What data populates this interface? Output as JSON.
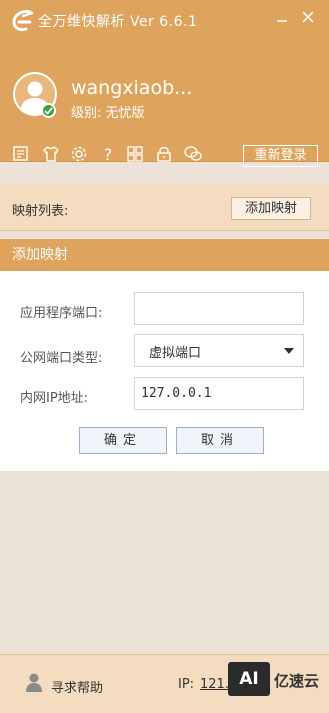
{
  "app": {
    "title": "全万维快解析 Ver 6.6.1"
  },
  "user": {
    "name": "wangxiaob...",
    "level": "级别: 无忧版",
    "relogin_label": "重新登录"
  },
  "toolbar": {
    "icons": [
      "notes-icon",
      "tshirt-icon",
      "gear-icon",
      "help-icon",
      "grid-icon",
      "lock-icon",
      "chat-icon"
    ]
  },
  "map_list": {
    "label": "映射列表:",
    "add_button": "添加映射"
  },
  "add_panel": {
    "title": "添加映射",
    "app_port_label": "应用程序端口:",
    "app_port_value": "",
    "public_port_type_label": "公网端口类型:",
    "public_port_type_value": "虚拟端口",
    "lan_ip_label": "内网IP地址:",
    "lan_ip_value": "127.0.0.1",
    "confirm_label": "确定",
    "cancel_label": "取消"
  },
  "footer": {
    "help_label": "寻求帮助",
    "ip_label": "IP:",
    "ip_value": "121.11.1.8",
    "watermark_box": "AI",
    "watermark_text": "亿速云"
  },
  "colors": {
    "accent": "#dea35c",
    "light_band": "#f3dcc0",
    "background": "#ece2d8",
    "status_online": "#3ba43b"
  }
}
